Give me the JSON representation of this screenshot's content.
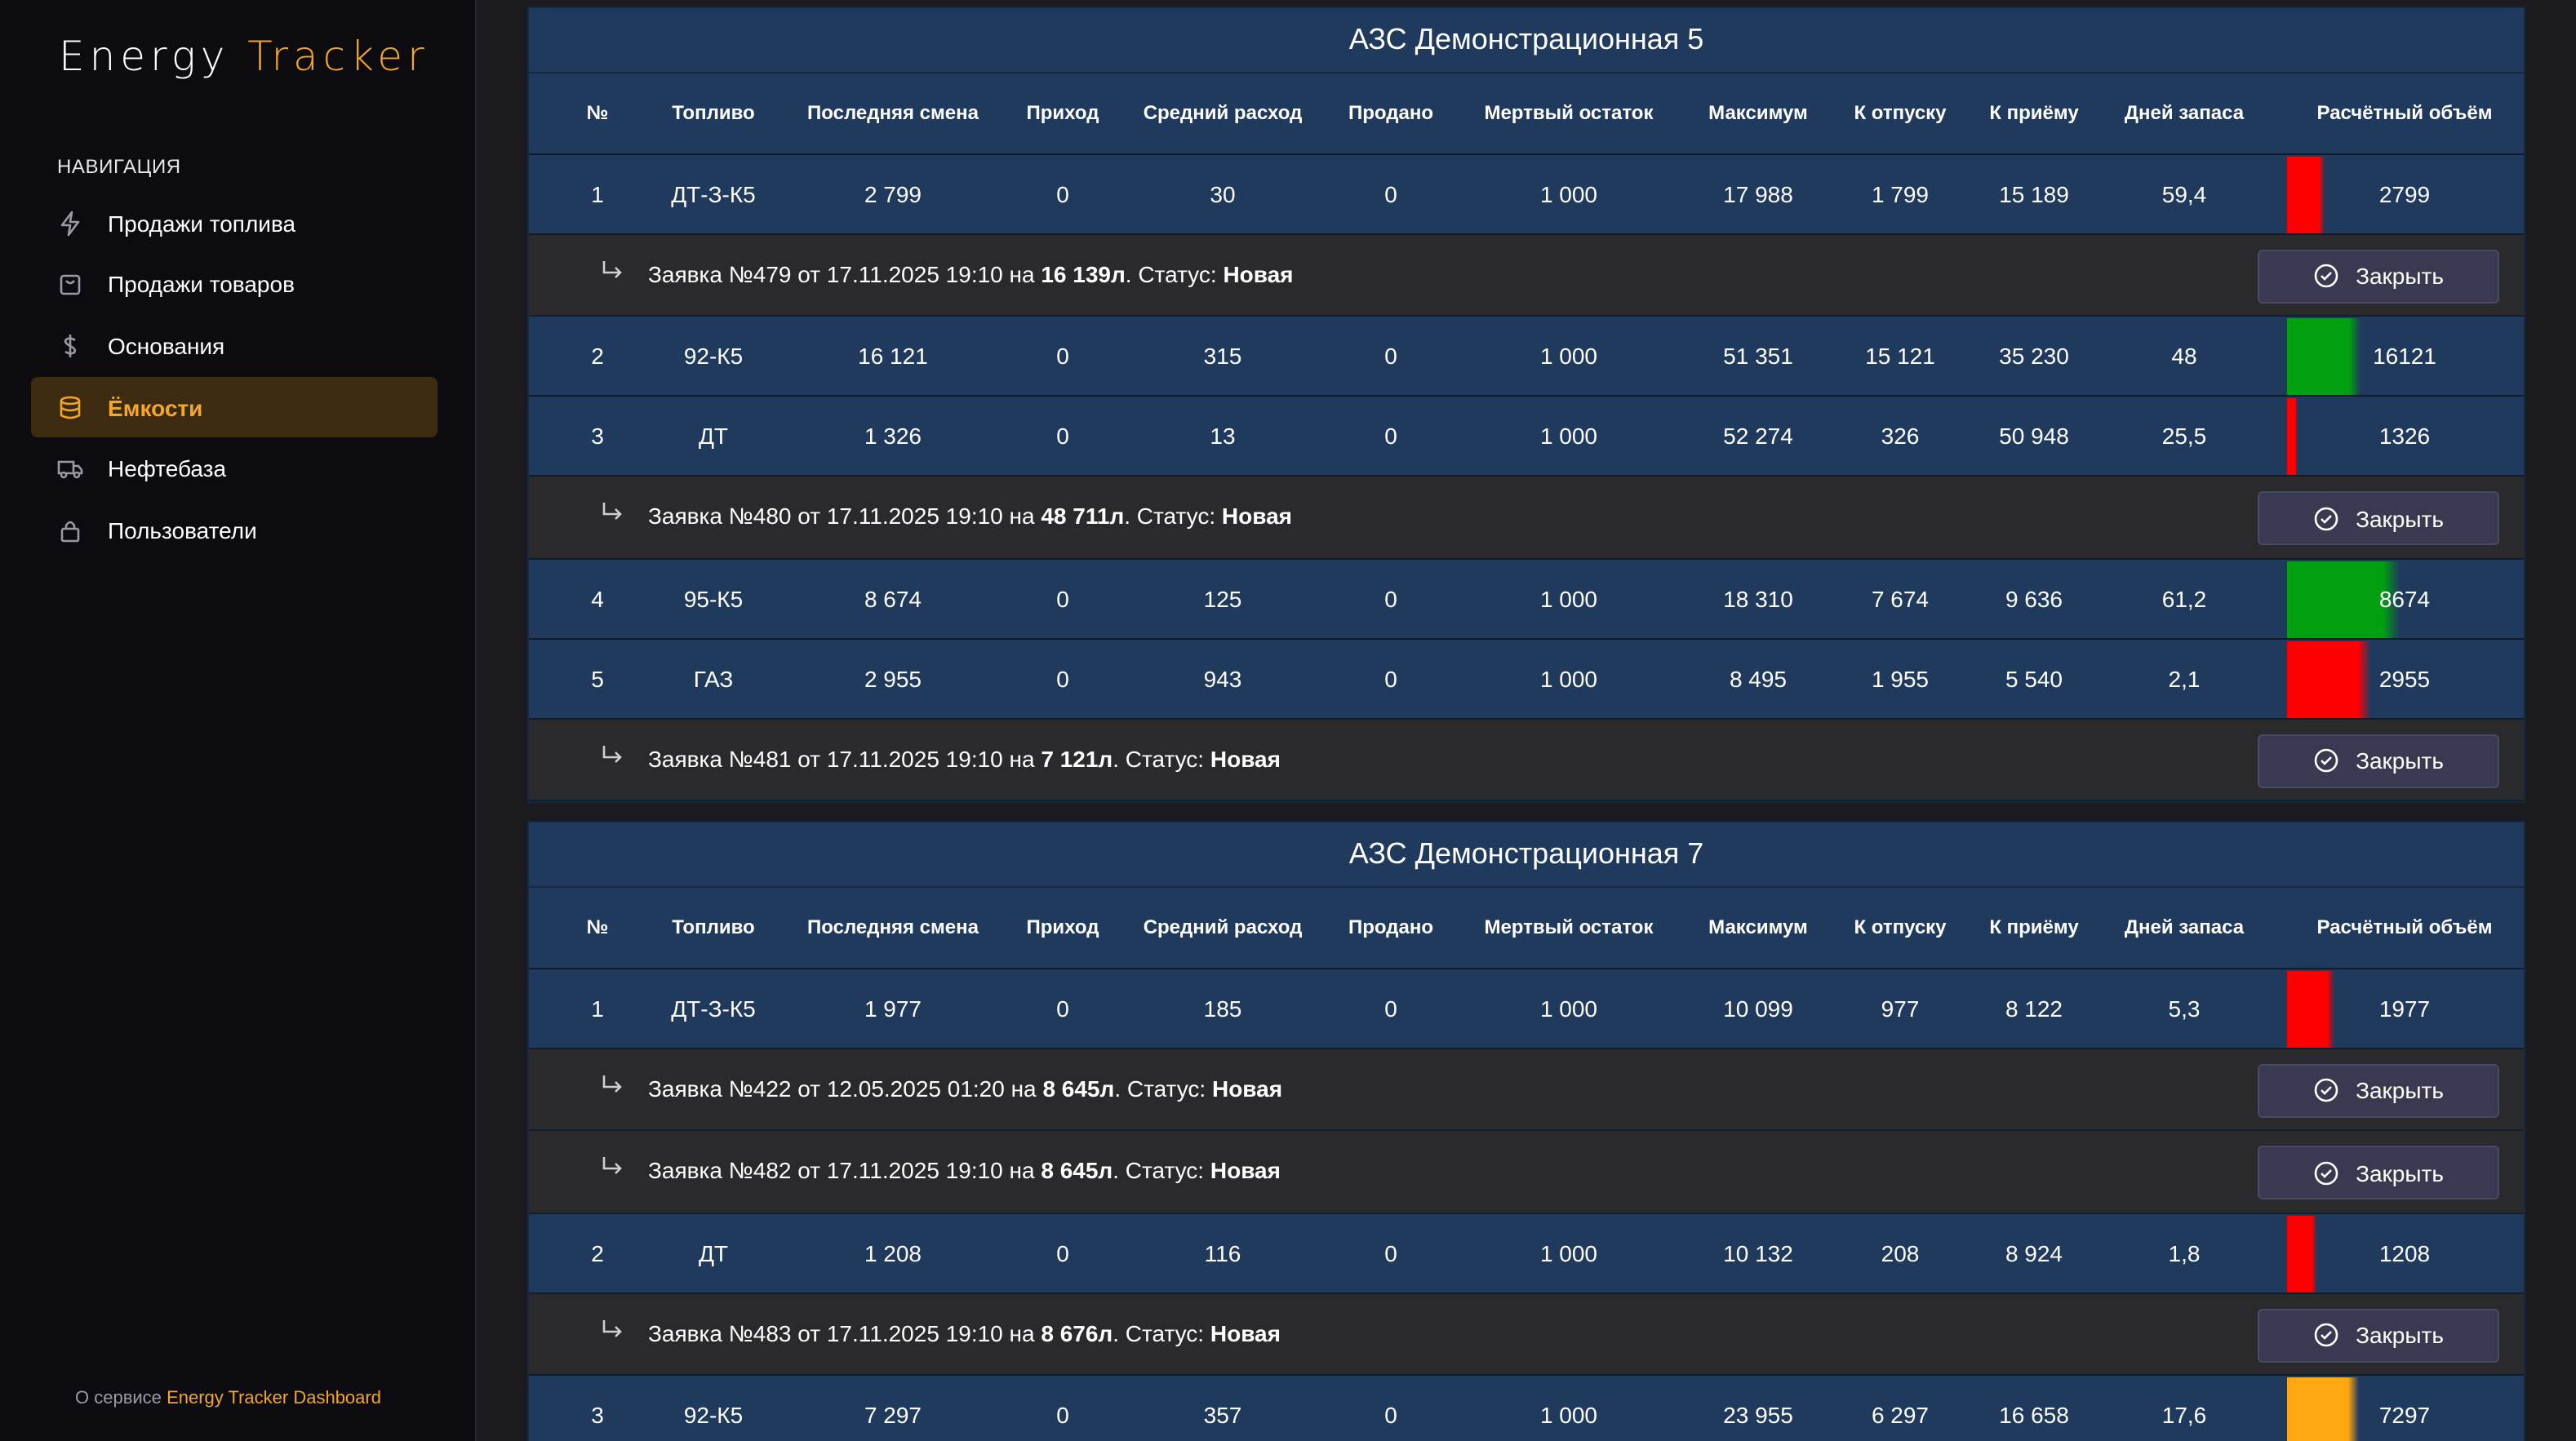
{
  "app": {
    "logo_part1": "Energy",
    "logo_part2": "Tracker"
  },
  "sidebar": {
    "heading": "НАВИГАЦИЯ",
    "items": [
      {
        "label": "Продажи топлива",
        "icon": "lightning-icon"
      },
      {
        "label": "Продажи товаров",
        "icon": "shopping-bag-icon"
      },
      {
        "label": "Основания",
        "icon": "dollar-icon"
      },
      {
        "label": "Ёмкости",
        "icon": "database-icon",
        "active": true
      },
      {
        "label": "Нефтебаза",
        "icon": "truck-icon"
      },
      {
        "label": "Пользователи",
        "icon": "lock-icon"
      }
    ],
    "footer_prefix": "О сервисе",
    "footer_link": "Energy Tracker Dashboard"
  },
  "colors": {
    "accent": "#f5a623",
    "panel": "#203a5e",
    "red": "#ff0000",
    "green": "#00a010",
    "orange": "#ffa811"
  },
  "columns": [
    "№",
    "Топливо",
    "Последняя смена",
    "Приход",
    "Средний расход",
    "Продано",
    "Мертвый остаток",
    "Максимум",
    "К отпуску",
    "К приёму",
    "Дней запаса",
    "Расчётный объём"
  ],
  "close_label": "Закрыть",
  "stations": [
    {
      "title": "АЗС Демонстрационная 5",
      "rows": [
        {
          "type": "fuel",
          "cells": [
            "1",
            "ДТ-З-К5",
            "2 799",
            "0",
            "30",
            "0",
            "1 000",
            "17 988",
            "1 799",
            "15 189",
            "59,4"
          ],
          "volume": "2799",
          "fill": 0.16,
          "color": "red"
        },
        {
          "type": "order",
          "prefix": "Заявка №479 от 17.11.2025 19:10 на ",
          "amount": "16 139л",
          "status_prefix": ". Статус: ",
          "status": "Новая"
        },
        {
          "type": "fuel",
          "cells": [
            "2",
            "92-К5",
            "16 121",
            "0",
            "315",
            "0",
            "1 000",
            "51 351",
            "15 121",
            "35 230",
            "48"
          ],
          "volume": "16121",
          "fill": 0.31,
          "color": "green"
        },
        {
          "type": "fuel",
          "cells": [
            "3",
            "ДТ",
            "1 326",
            "0",
            "13",
            "0",
            "1 000",
            "52 274",
            "326",
            "50 948",
            "25,5"
          ],
          "volume": "1326",
          "fill": 0.03,
          "color": "red"
        },
        {
          "type": "order",
          "prefix": "Заявка №480 от 17.11.2025 19:10 на ",
          "amount": "48 711л",
          "status_prefix": ". Статус: ",
          "status": "Новая"
        },
        {
          "type": "fuel",
          "cells": [
            "4",
            "95-К5",
            "8 674",
            "0",
            "125",
            "0",
            "1 000",
            "18 310",
            "7 674",
            "9 636",
            "61,2"
          ],
          "volume": "8674",
          "fill": 0.47,
          "color": "green"
        },
        {
          "type": "fuel",
          "cells": [
            "5",
            "ГАЗ",
            "2 955",
            "0",
            "943",
            "0",
            "1 000",
            "8 495",
            "1 955",
            "5 540",
            "2,1"
          ],
          "volume": "2955",
          "fill": 0.35,
          "color": "red"
        },
        {
          "type": "order",
          "prefix": "Заявка №481 от 17.11.2025 19:10 на ",
          "amount": "7 121л",
          "status_prefix": ". Статус: ",
          "status": "Новая"
        }
      ]
    },
    {
      "title": "АЗС Демонстрационная 7",
      "rows": [
        {
          "type": "fuel",
          "cells": [
            "1",
            "ДТ-З-К5",
            "1 977",
            "0",
            "185",
            "0",
            "1 000",
            "10 099",
            "977",
            "8 122",
            "5,3"
          ],
          "volume": "1977",
          "fill": 0.2,
          "color": "red"
        },
        {
          "type": "order",
          "prefix": "Заявка №422 от 12.05.2025 01:20 на ",
          "amount": "8 645л",
          "status_prefix": ". Статус: ",
          "status": "Новая"
        },
        {
          "type": "order",
          "prefix": "Заявка №482 от 17.11.2025 19:10 на ",
          "amount": "8 645л",
          "status_prefix": ". Статус: ",
          "status": "Новая"
        },
        {
          "type": "fuel",
          "cells": [
            "2",
            "ДТ",
            "1 208",
            "0",
            "116",
            "0",
            "1 000",
            "10 132",
            "208",
            "8 924",
            "1,8"
          ],
          "volume": "1208",
          "fill": 0.12,
          "color": "red"
        },
        {
          "type": "order",
          "prefix": "Заявка №483 от 17.11.2025 19:10 на ",
          "amount": "8 676л",
          "status_prefix": ". Статус: ",
          "status": "Новая"
        },
        {
          "type": "fuel",
          "cells": [
            "3",
            "92-К5",
            "7 297",
            "0",
            "357",
            "0",
            "1 000",
            "23 955",
            "6 297",
            "16 658",
            "17,6"
          ],
          "volume": "7297",
          "fill": 0.3,
          "color": "orange"
        }
      ]
    }
  ]
}
